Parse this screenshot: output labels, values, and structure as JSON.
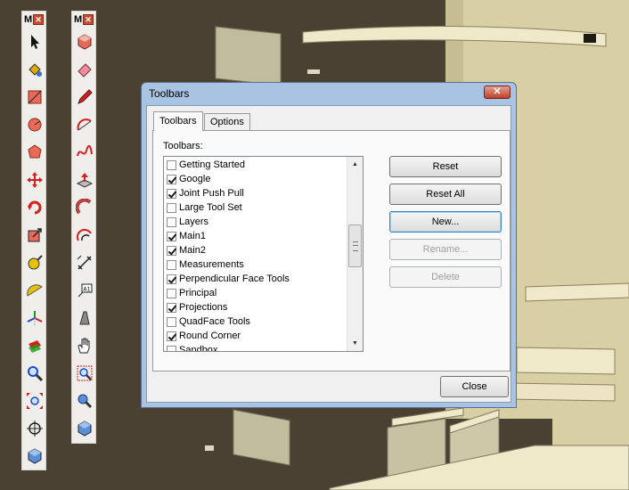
{
  "dialog": {
    "title": "Toolbars",
    "tabs": [
      {
        "label": "Toolbars",
        "active": true
      },
      {
        "label": "Options",
        "active": false
      }
    ],
    "list_label": "Toolbars:",
    "items": [
      {
        "label": "Getting Started",
        "checked": false
      },
      {
        "label": "Google",
        "checked": true
      },
      {
        "label": "Joint Push Pull",
        "checked": true
      },
      {
        "label": "Large Tool Set",
        "checked": false
      },
      {
        "label": "Layers",
        "checked": false
      },
      {
        "label": "Main1",
        "checked": true
      },
      {
        "label": "Main2",
        "checked": true
      },
      {
        "label": "Measurements",
        "checked": false
      },
      {
        "label": "Perpendicular Face Tools",
        "checked": true
      },
      {
        "label": "Principal",
        "checked": false
      },
      {
        "label": "Projections",
        "checked": true
      },
      {
        "label": "QuadFace Tools",
        "checked": false
      },
      {
        "label": "Round Corner",
        "checked": true
      },
      {
        "label": "Sandbox",
        "checked": false
      }
    ],
    "buttons": {
      "reset": "Reset",
      "reset_all": "Reset All",
      "new": "New...",
      "rename": "Rename...",
      "delete": "Delete",
      "close": "Close"
    },
    "close_glyph": "✕"
  },
  "toolbars": {
    "left": {
      "badge": "M",
      "icons": [
        "select-arrow-icon",
        "paint-bucket-icon",
        "rectangle-icon",
        "circle-icon",
        "polygon-icon",
        "move-icon",
        "rotate-icon",
        "scale-icon",
        "tape-measure-icon",
        "protractor-icon",
        "axes-icon",
        "section-plane-icon",
        "zoom-icon",
        "zoom-extents-icon",
        "position-camera-icon",
        "component-icon"
      ]
    },
    "right": {
      "badge": "M",
      "icons": [
        "make-component-icon",
        "eraser-icon",
        "pencil-icon",
        "arc-icon",
        "freehand-icon",
        "push-pull-icon",
        "follow-me-icon",
        "offset-icon",
        "dimension-icon",
        "text-icon",
        "walk-icon",
        "pan-icon",
        "zoom-window-icon",
        "look-around-icon",
        "component-icon"
      ]
    },
    "close_glyph": "✕"
  },
  "colors": {
    "scene_bg": "#4a4133",
    "panel_cream": "#e9e2c6",
    "dialog_frame": "#a9c3e3"
  }
}
